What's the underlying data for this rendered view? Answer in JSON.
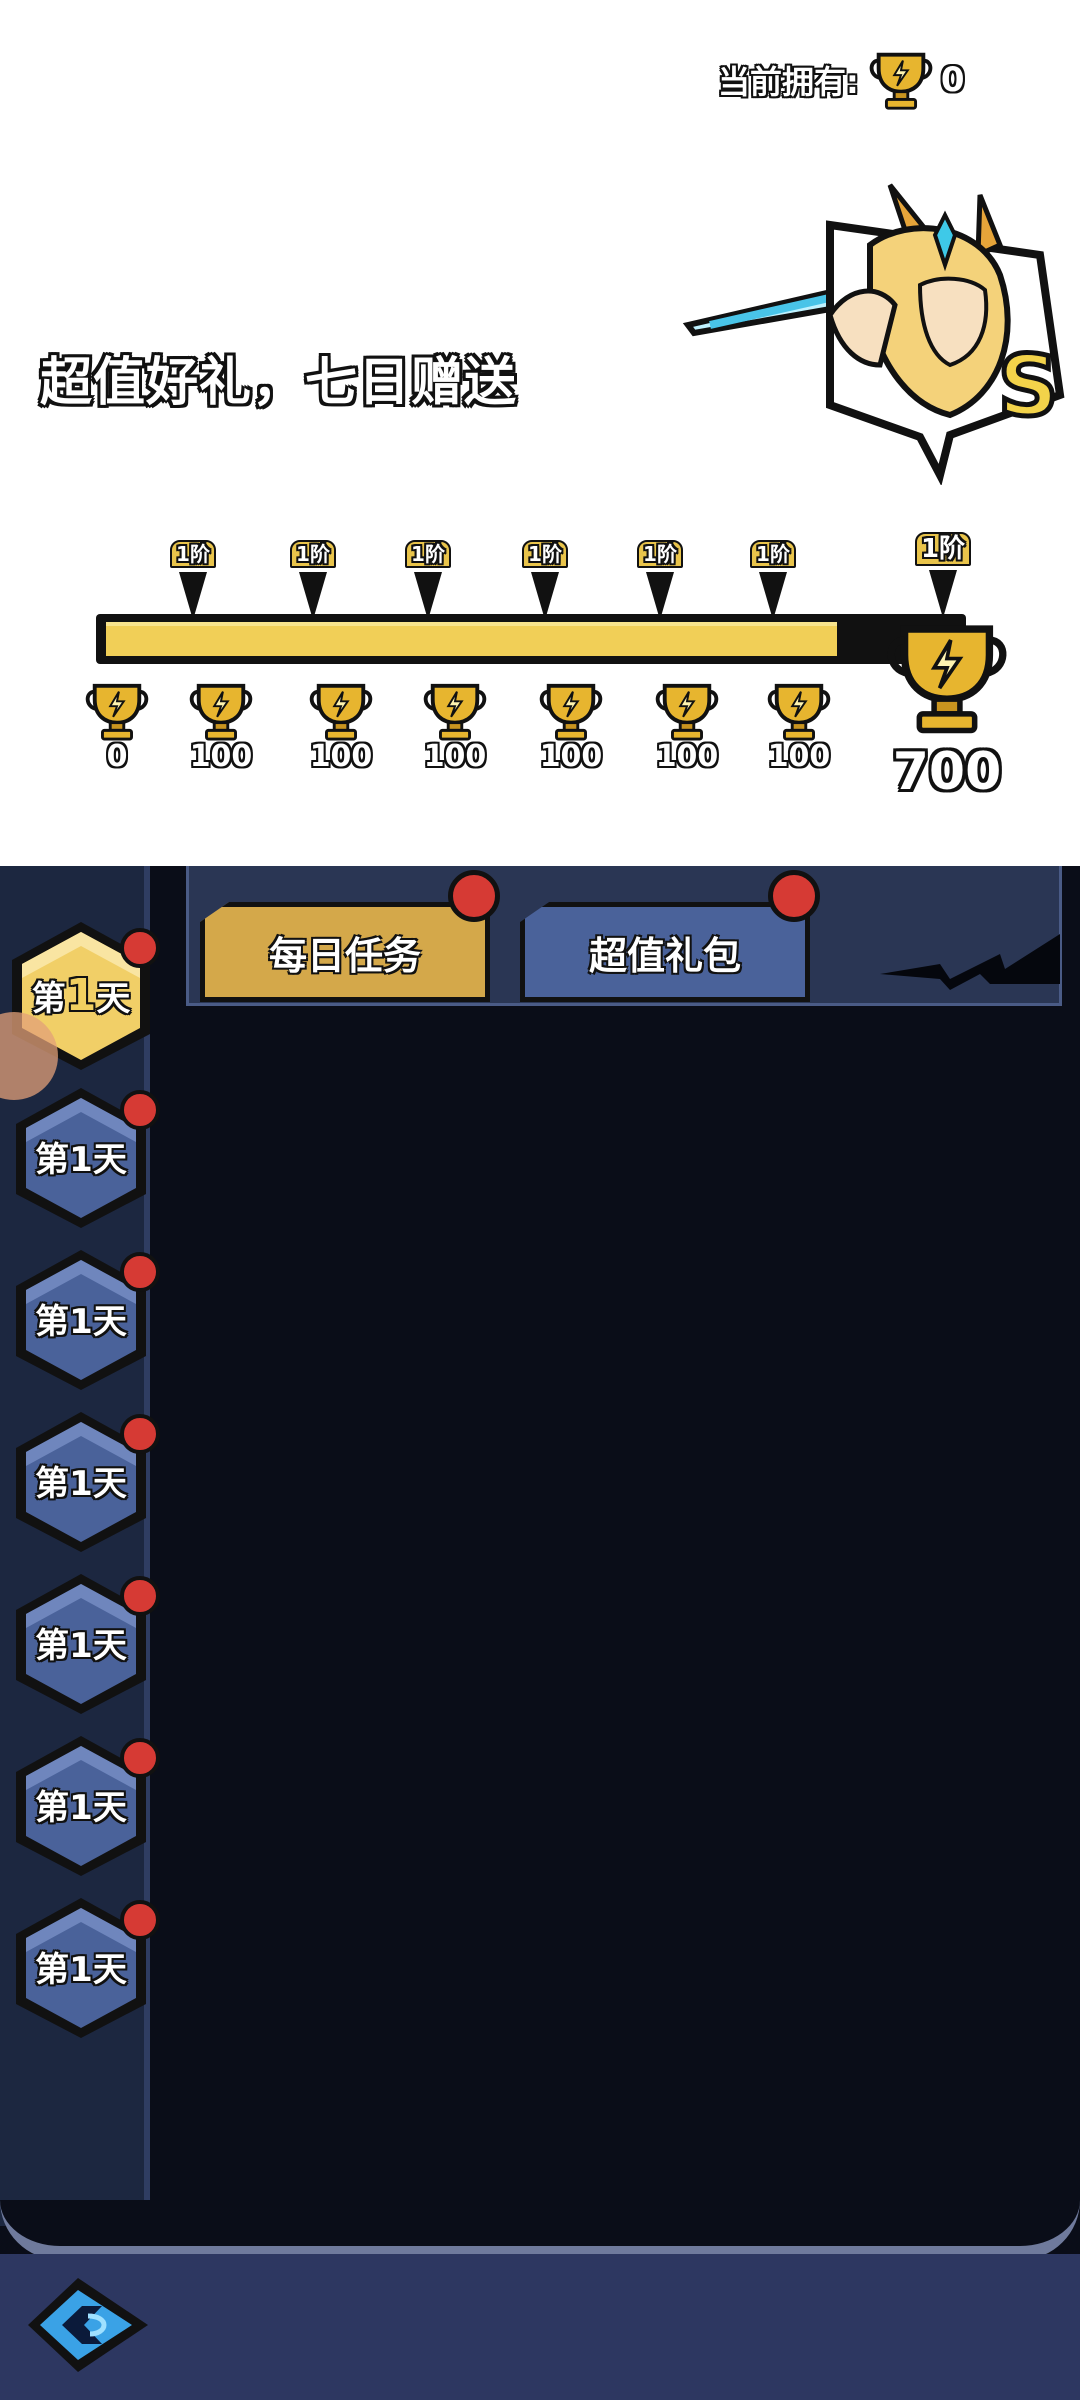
{
  "header": {
    "owned_label": "当前拥有:",
    "owned_count": "0",
    "title": "超值好礼，七日赠送",
    "hero_rank": "S"
  },
  "progress": {
    "fill_fraction": 0.86,
    "markers": [
      {
        "tag": "1阶"
      },
      {
        "tag": "1阶"
      },
      {
        "tag": "1阶"
      },
      {
        "tag": "1阶"
      },
      {
        "tag": "1阶"
      },
      {
        "tag": "1阶"
      },
      {
        "tag": "1阶"
      }
    ],
    "rewards": [
      "0",
      "100",
      "100",
      "100",
      "100",
      "100",
      "100"
    ],
    "final_reward": "700"
  },
  "tabs": {
    "daily": "每日任务",
    "gift": "超值礼包"
  },
  "days": [
    {
      "prefix": "第",
      "num": "1",
      "suffix": "天",
      "active": true
    },
    {
      "prefix": "第",
      "num": "1",
      "suffix": "天",
      "active": false
    },
    {
      "prefix": "第",
      "num": "1",
      "suffix": "天",
      "active": false
    },
    {
      "prefix": "第",
      "num": "1",
      "suffix": "天",
      "active": false
    },
    {
      "prefix": "第",
      "num": "1",
      "suffix": "天",
      "active": false
    },
    {
      "prefix": "第",
      "num": "1",
      "suffix": "天",
      "active": false
    },
    {
      "prefix": "第",
      "num": "1",
      "suffix": "天",
      "active": false
    }
  ],
  "colors": {
    "gold": "#f1cf57",
    "tab_daily": "#d4a84a",
    "tab_gift": "#4a629a",
    "panel": "#0a0d18",
    "badge": "#d63a34"
  }
}
